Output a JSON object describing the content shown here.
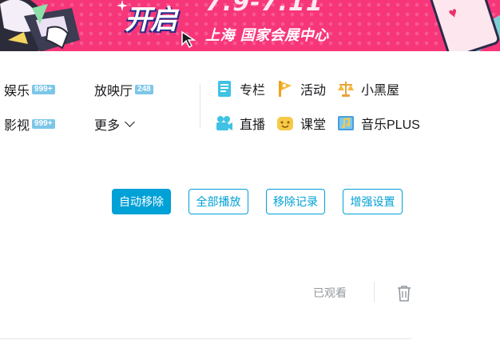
{
  "banner": {
    "open_text": "开启",
    "date_text": "7.9-7.11",
    "venue_text": "上海 国家会展中心",
    "colors": {
      "background": "#f7367a",
      "accent": "#2a2a8a"
    }
  },
  "nav": {
    "left": [
      {
        "label": "娱乐",
        "badge": "999+"
      },
      {
        "label": "影视",
        "badge": "999+"
      },
      {
        "label": "放映厅",
        "badge": "248"
      },
      {
        "label": "更多"
      }
    ],
    "right": [
      {
        "label": "专栏",
        "icon": "column-icon"
      },
      {
        "label": "活动",
        "icon": "activity-flag-icon"
      },
      {
        "label": "小黑屋",
        "icon": "scales-icon"
      },
      {
        "label": "直播",
        "icon": "live-camera-icon"
      },
      {
        "label": "课堂",
        "icon": "classroom-icon"
      },
      {
        "label": "音乐PLUS",
        "icon": "music-icon"
      }
    ]
  },
  "actions": {
    "auto_remove": "自动移除",
    "play_all": "全部播放",
    "remove_records": "移除记录",
    "enhanced_settings": "增强设置"
  },
  "history": {
    "watched_label": "已观看"
  },
  "colors": {
    "primary": "#00a1d6",
    "badge": "#7dc6e8",
    "muted": "#9499a0"
  }
}
